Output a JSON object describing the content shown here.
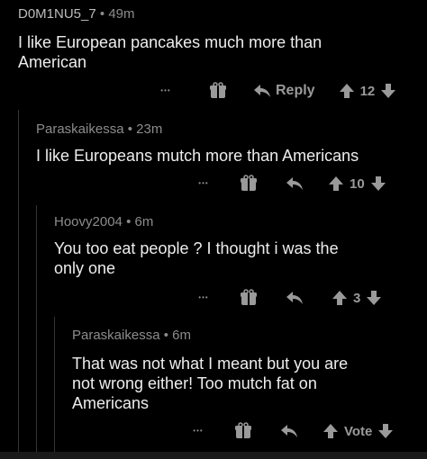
{
  "comments": [
    {
      "author": "D0M1NU5_7",
      "separator": "•",
      "age": "49m",
      "lines": [
        "I like European pancakes much more than",
        "American"
      ],
      "more": "•••",
      "reply_label": "Reply",
      "score": "12"
    },
    {
      "author": "Paraskaikessa",
      "separator": "•",
      "age": "23m",
      "lines": [
        "I like Europeans mutch more than Americans"
      ],
      "more": "•••",
      "score": "10"
    },
    {
      "author": "Hoovy2004",
      "separator": "•",
      "age": "6m",
      "lines": [
        "You too eat people ? I thought i was the",
        "only one"
      ],
      "more": "•••",
      "score": "3"
    },
    {
      "author": "Paraskaikessa",
      "separator": "•",
      "age": "6m",
      "lines": [
        "That was not what I meant but you are",
        "not wrong either! Too mutch fat on",
        "Americans"
      ],
      "more": "•••",
      "score": "Vote"
    }
  ],
  "icons": {
    "more": "more-options-icon",
    "award": "award-gift-icon",
    "reply": "reply-arrow-icon",
    "upvote": "upvote-arrow-icon",
    "downvote": "downvote-arrow-icon"
  },
  "colors": {
    "background": "#000000",
    "text": "#ededed",
    "muted": "#8c8c8c",
    "thread_line": "#343434"
  }
}
